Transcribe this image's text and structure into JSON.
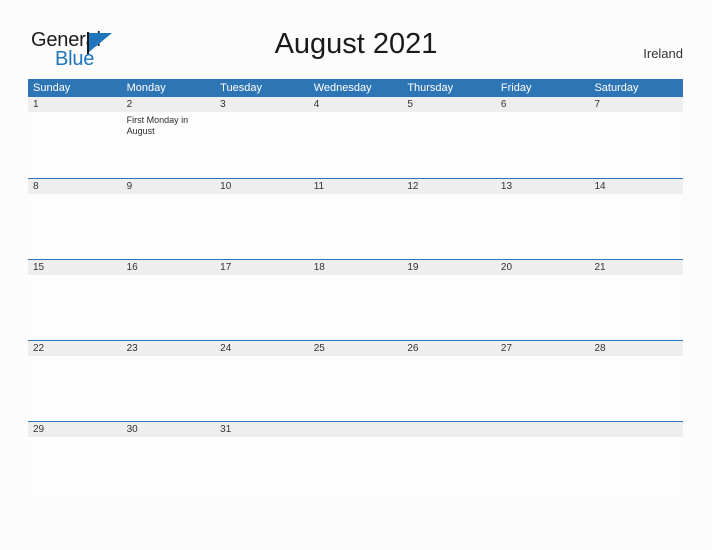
{
  "brand": {
    "name_part1": "General",
    "name_part2": "Blue",
    "flag_icon": "flag-triangle-icon"
  },
  "header": {
    "title": "August 2021",
    "country": "Ireland"
  },
  "calendar": {
    "weekdays": [
      "Sunday",
      "Monday",
      "Tuesday",
      "Wednesday",
      "Thursday",
      "Friday",
      "Saturday"
    ],
    "colors": {
      "header_blue": "#2e75b6",
      "daynum_band": "#eeeeee",
      "brand_blue": "#1f76bd",
      "page_background": "#fcfcfc"
    },
    "weeks": [
      {
        "days": [
          {
            "num": "1",
            "events": []
          },
          {
            "num": "2",
            "events": [
              "First Monday in August"
            ]
          },
          {
            "num": "3",
            "events": []
          },
          {
            "num": "4",
            "events": []
          },
          {
            "num": "5",
            "events": []
          },
          {
            "num": "6",
            "events": []
          },
          {
            "num": "7",
            "events": []
          }
        ]
      },
      {
        "days": [
          {
            "num": "8",
            "events": []
          },
          {
            "num": "9",
            "events": []
          },
          {
            "num": "10",
            "events": []
          },
          {
            "num": "11",
            "events": []
          },
          {
            "num": "12",
            "events": []
          },
          {
            "num": "13",
            "events": []
          },
          {
            "num": "14",
            "events": []
          }
        ]
      },
      {
        "days": [
          {
            "num": "15",
            "events": []
          },
          {
            "num": "16",
            "events": []
          },
          {
            "num": "17",
            "events": []
          },
          {
            "num": "18",
            "events": []
          },
          {
            "num": "19",
            "events": []
          },
          {
            "num": "20",
            "events": []
          },
          {
            "num": "21",
            "events": []
          }
        ]
      },
      {
        "days": [
          {
            "num": "22",
            "events": []
          },
          {
            "num": "23",
            "events": []
          },
          {
            "num": "24",
            "events": []
          },
          {
            "num": "25",
            "events": []
          },
          {
            "num": "26",
            "events": []
          },
          {
            "num": "27",
            "events": []
          },
          {
            "num": "28",
            "events": []
          }
        ]
      },
      {
        "days": [
          {
            "num": "29",
            "events": []
          },
          {
            "num": "30",
            "events": []
          },
          {
            "num": "31",
            "events": []
          },
          {
            "num": "",
            "events": []
          },
          {
            "num": "",
            "events": []
          },
          {
            "num": "",
            "events": []
          },
          {
            "num": "",
            "events": []
          }
        ]
      }
    ]
  }
}
